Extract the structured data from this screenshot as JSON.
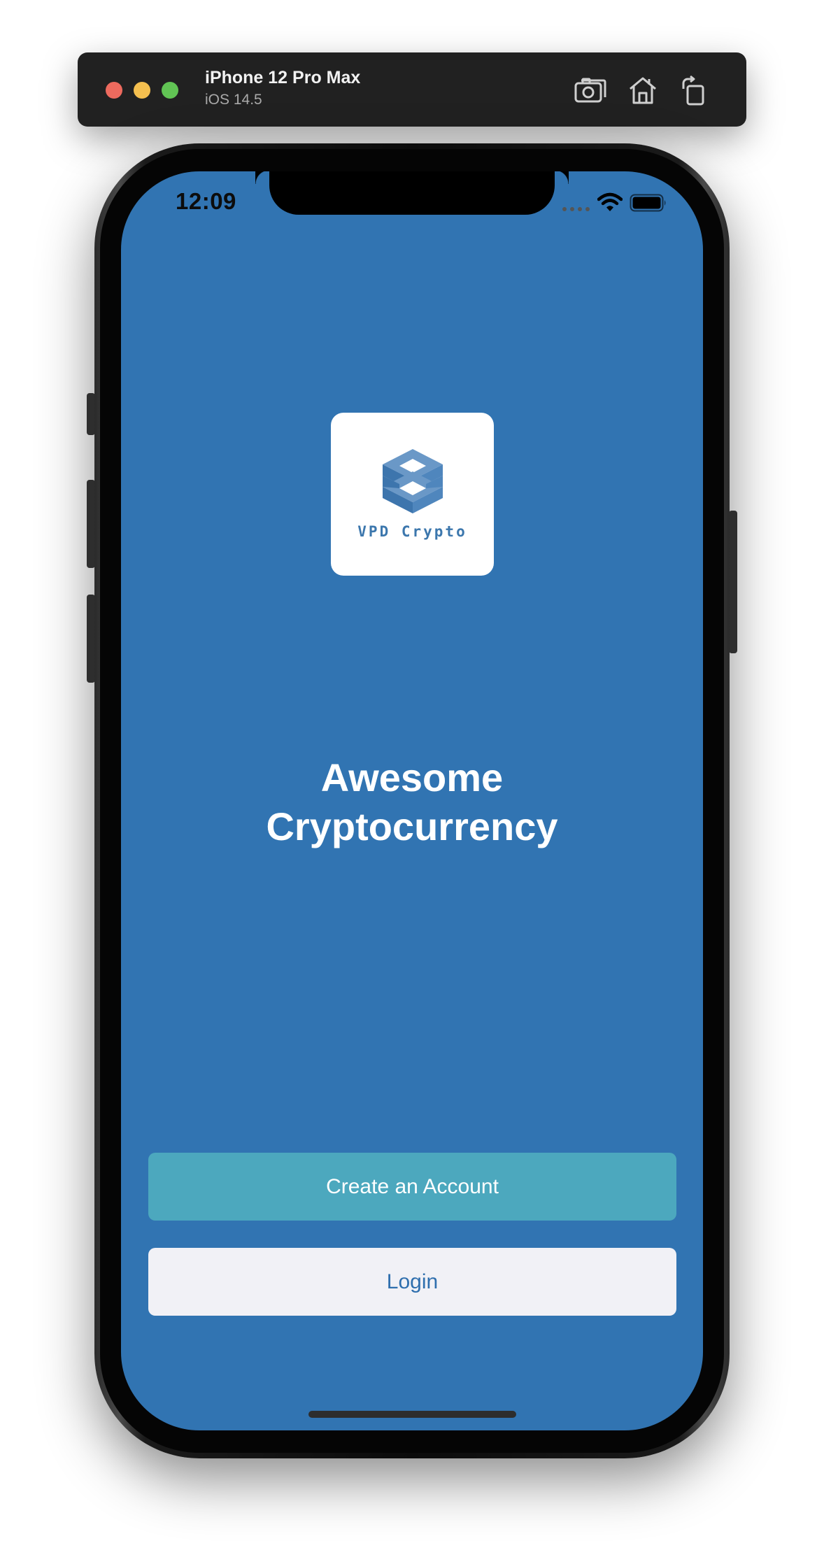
{
  "simulator": {
    "device_name": "iPhone 12 Pro Max",
    "os_version": "iOS 14.5",
    "toolbar_icons": [
      "screenshot-icon",
      "home-icon",
      "rotate-icon"
    ]
  },
  "status_bar": {
    "time": "12:09",
    "icons": [
      "cellular-signal-icon",
      "wifi-icon",
      "battery-icon"
    ]
  },
  "logo": {
    "text": "VPD Crypto",
    "icon": "isometric-cube-logo-icon"
  },
  "headline": {
    "line1": "Awesome",
    "line2": "Cryptocurrency"
  },
  "buttons": {
    "create_account": "Create an Account",
    "login": "Login"
  },
  "colors": {
    "background": "#3174b2",
    "create_button": "#4ca8be",
    "login_button": "#f1f1f6",
    "login_text": "#2f6fae",
    "logo_accent": "#3c77ad"
  }
}
